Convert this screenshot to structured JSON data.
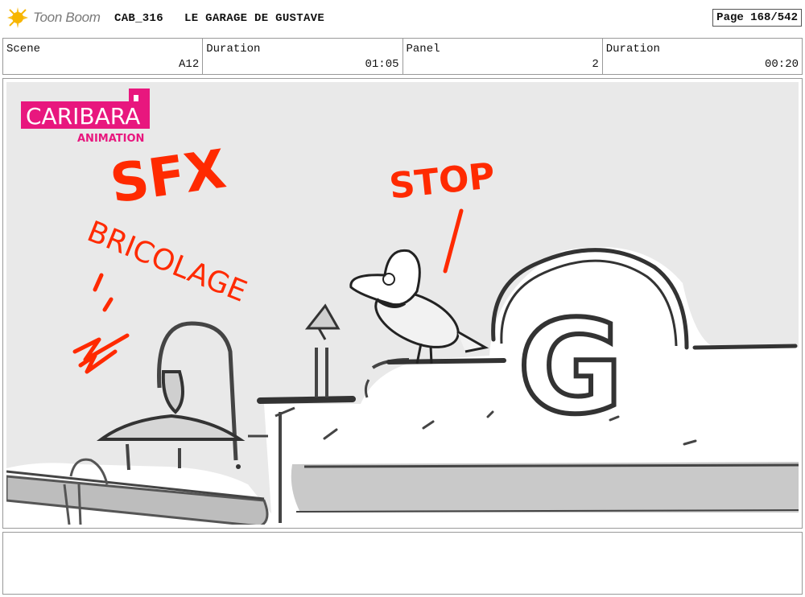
{
  "header": {
    "brand": "Toon Boom",
    "project_code": "CAB_316",
    "project_title": "LE GARAGE DE GUSTAVE",
    "page_label": "Page 168/542"
  },
  "info": {
    "scene_label": "Scene",
    "scene_value": "A12",
    "scene_duration_label": "Duration",
    "scene_duration_value": "01:05",
    "panel_label": "Panel",
    "panel_value": "2",
    "panel_duration_label": "Duration",
    "panel_duration_value": "00:20"
  },
  "artwork": {
    "studio_logo_main": "CARIBARA",
    "studio_logo_sub": "ANIMATION",
    "sfx_text": "SFX",
    "bricolage_text": "BRICOLAGE",
    "stop_text": "STOP",
    "sign_letter": "G",
    "annotation_color": "#ff2a00",
    "logo_color": "#e8177e"
  },
  "notes": {
    "text": ""
  }
}
